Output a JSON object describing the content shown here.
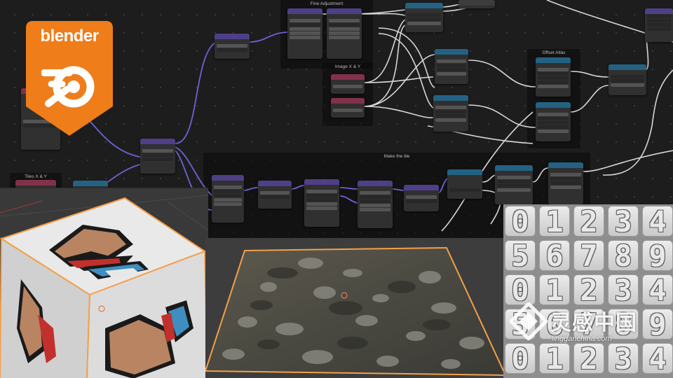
{
  "app": {
    "name": "blender"
  },
  "frames": {
    "fine_adjustment": "Fine Adjustment",
    "image_xy": "Image X & Y",
    "offset_atlas": "Offset Atlas",
    "make_the_tile": "Make the tile",
    "tiles_xy": "Tiles X & Y"
  },
  "numbers_panel": {
    "rows": [
      [
        "0",
        "1",
        "2",
        "3",
        "4"
      ],
      [
        "5",
        "6",
        "7",
        "8",
        "9"
      ],
      [
        "0",
        "1",
        "2",
        "3",
        "4"
      ],
      [
        "5",
        "6",
        "7",
        "8",
        "9"
      ],
      [
        "0",
        "1",
        "2",
        "3",
        "4"
      ]
    ]
  },
  "watermark": {
    "chinese": "灵感中国",
    "url": "lingganchina.com"
  },
  "colors": {
    "blender_orange": "#ee7d1a",
    "node_wire": "#d7d7d7",
    "vector_wire": "#6c63d6",
    "selection_outline": "#f2a04a"
  }
}
